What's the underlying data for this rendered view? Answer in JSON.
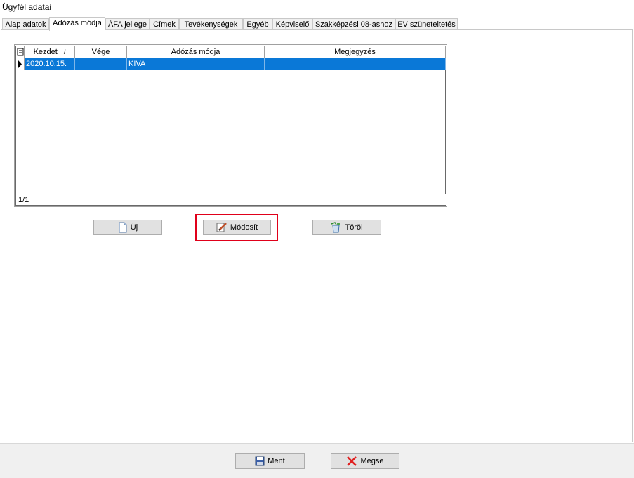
{
  "window": {
    "title": "Ügyfél adatai"
  },
  "tabs": [
    {
      "label": "Alap adatok"
    },
    {
      "label": "Adózás módja"
    },
    {
      "label": "ÁFA jellege"
    },
    {
      "label": "Címek"
    },
    {
      "label": "Tevékenységek"
    },
    {
      "label": "Egyéb"
    },
    {
      "label": "Képviselő"
    },
    {
      "label": "Szakképzési 08-ashoz"
    },
    {
      "label": "EV szüneteltetés"
    }
  ],
  "active_tab": "Adózás módja",
  "grid": {
    "columns": [
      "Kezdet",
      "Vége",
      "Adózás módja",
      "Megjegyzés"
    ],
    "sort_indicator": "/",
    "rows": [
      {
        "kezdet": "2020.10.15.",
        "vege": "",
        "adozas_modja": "KIVA",
        "megjegyzes": ""
      }
    ],
    "footer": "1/1"
  },
  "buttons": {
    "new": "Új",
    "modify": "Módosít",
    "delete": "Töröl",
    "save": "Ment",
    "cancel": "Mégse"
  },
  "colors": {
    "selection": "#0a78d7",
    "highlight": "#e0001a"
  },
  "icons": {
    "new": "new-document-icon",
    "modify": "edit-pencil-icon",
    "delete": "delete-recycle-icon",
    "save": "floppy-disk-icon",
    "cancel": "red-x-icon"
  }
}
